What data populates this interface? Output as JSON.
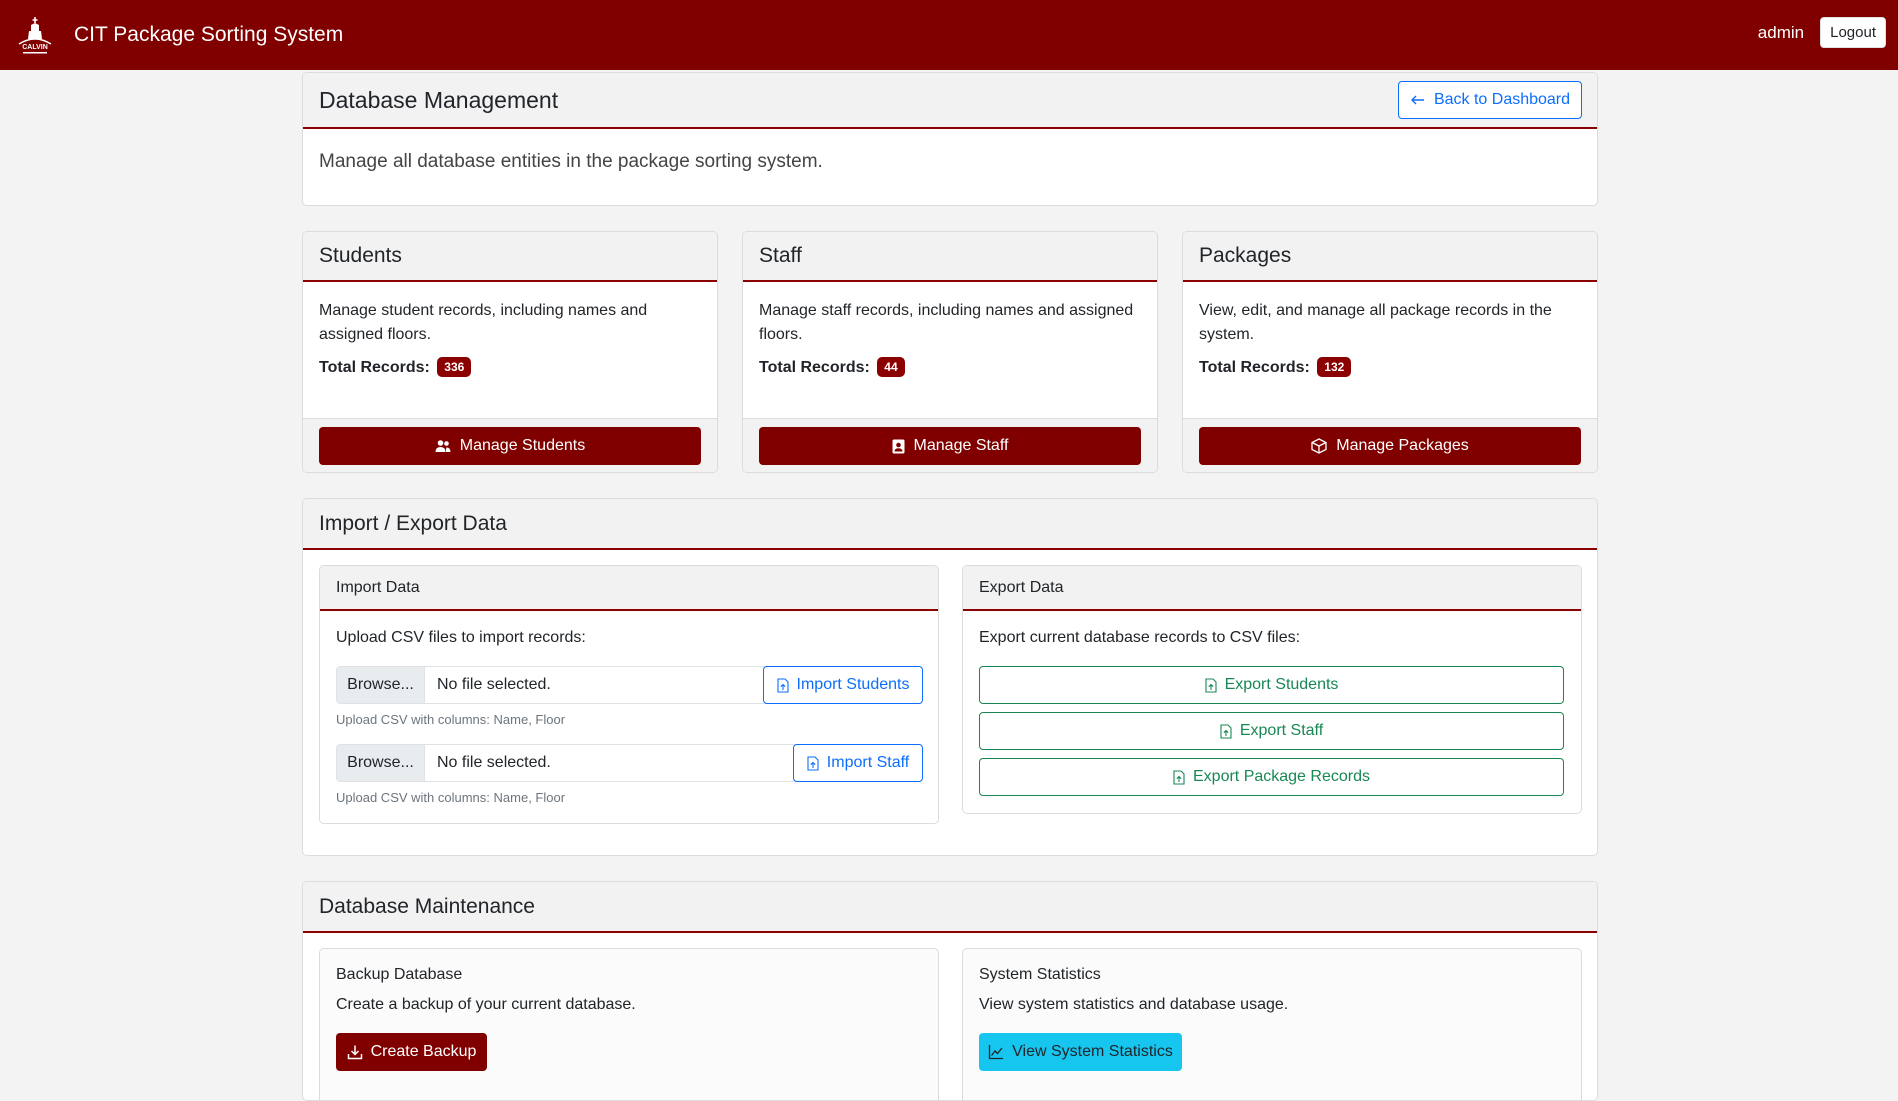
{
  "navbar": {
    "title": "CIT Package Sorting System",
    "logo_text": "CALVIN",
    "user": "admin",
    "logout_label": "Logout"
  },
  "header_card": {
    "title": "Database Management",
    "back_label": "Back to Dashboard",
    "description": "Manage all database entities in the package sorting system."
  },
  "entity_cards": [
    {
      "title": "Students",
      "description": "Manage student records, including names and assigned floors.",
      "total_label": "Total Records:",
      "total": "336",
      "button_label": "Manage Students",
      "icon": "people-icon"
    },
    {
      "title": "Staff",
      "description": "Manage staff records, including names and assigned floors.",
      "total_label": "Total Records:",
      "total": "44",
      "button_label": "Manage Staff",
      "icon": "badge-icon"
    },
    {
      "title": "Packages",
      "description": "View, edit, and manage all package records in the system.",
      "total_label": "Total Records:",
      "total": "132",
      "button_label": "Manage Packages",
      "icon": "box-icon"
    }
  ],
  "import_export": {
    "title": "Import / Export Data",
    "import": {
      "title": "Import Data",
      "intro": "Upload CSV files to import records:",
      "rows": [
        {
          "browse": "Browse...",
          "status": "No file selected.",
          "button": "Import Students",
          "help": "Upload CSV with columns: Name, Floor"
        },
        {
          "browse": "Browse...",
          "status": "No file selected.",
          "button": "Import Staff",
          "help": "Upload CSV with columns: Name, Floor"
        }
      ]
    },
    "export": {
      "title": "Export Data",
      "intro": "Export current database records to CSV files:",
      "buttons": [
        "Export Students",
        "Export Staff",
        "Export Package Records"
      ]
    }
  },
  "maintenance": {
    "title": "Database Maintenance",
    "backup": {
      "title": "Backup Database",
      "description": "Create a backup of your current database.",
      "button": "Create Backup"
    },
    "stats": {
      "title": "System Statistics",
      "description": "View system statistics and database usage.",
      "button": "View System Statistics"
    }
  },
  "colors": {
    "brand": "#800000",
    "accent_blue": "#0d6efd",
    "accent_green": "#198754",
    "accent_cyan": "#17c6ef"
  }
}
